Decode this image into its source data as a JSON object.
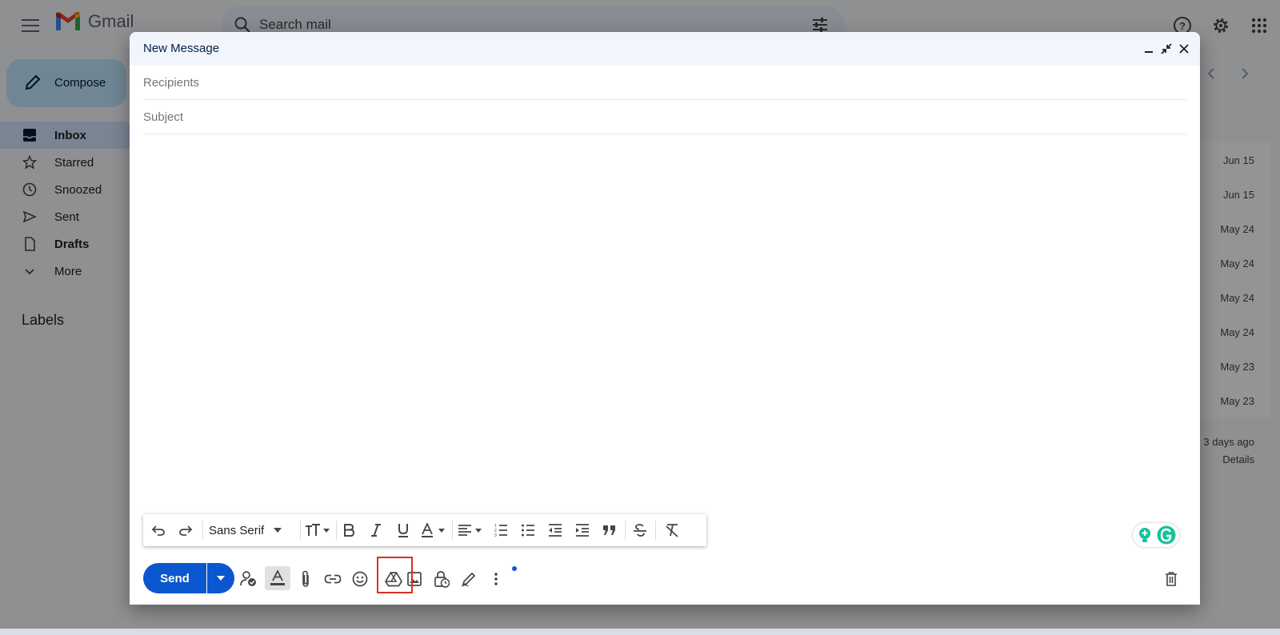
{
  "app": {
    "name": "Gmail"
  },
  "search": {
    "placeholder": "Search mail"
  },
  "sidebar": {
    "compose_label": "Compose",
    "items": [
      {
        "label": "Inbox",
        "icon": "inbox-icon",
        "active": true,
        "bold": true
      },
      {
        "label": "Starred",
        "icon": "star-icon"
      },
      {
        "label": "Snoozed",
        "icon": "clock-icon"
      },
      {
        "label": "Sent",
        "icon": "send-icon"
      },
      {
        "label": "Drafts",
        "icon": "draft-icon",
        "bold": true
      },
      {
        "label": "More",
        "icon": "chevron-down-icon"
      }
    ],
    "labels_title": "Labels"
  },
  "mail_list": {
    "dates": [
      "Jun 15",
      "Jun 15",
      "May 24",
      "May 24",
      "May 24",
      "May 24",
      "May 23",
      "May 23"
    ],
    "last_activity": "3 days ago",
    "details_link": "Details"
  },
  "compose": {
    "title": "New Message",
    "recipients_placeholder": "Recipients",
    "subject_placeholder": "Subject",
    "font_name": "Sans Serif",
    "send_label": "Send"
  },
  "colors": {
    "accent": "#0b57d0",
    "highlight_border": "#d93025",
    "grammarly": "#15c39a"
  }
}
